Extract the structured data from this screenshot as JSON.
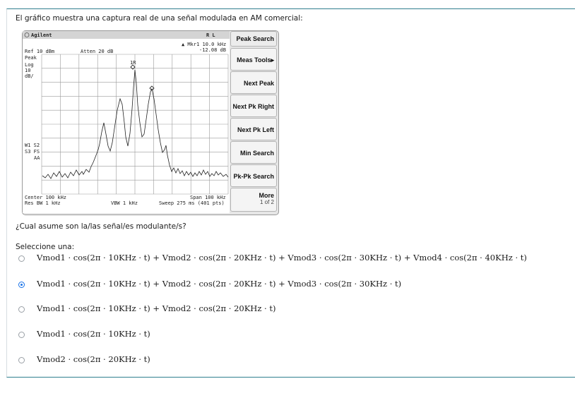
{
  "intro_text": "El gráfico muestra una captura real de una señal modulada en AM comercial:",
  "analyzer": {
    "brand": "Agilent",
    "rl_label": "R L",
    "marker_label": "▲ Mkr1  10.0 kHz",
    "marker_value": "-12.08 dB",
    "ref_level": "Ref 10 dBm",
    "attenuation": "Atten 20 dB",
    "detector": "Peak",
    "scale": [
      "Log",
      "10",
      "dB/"
    ],
    "trace_flags": [
      "W1  S2",
      "S3  FS",
      "AA"
    ],
    "center": "Center 100 kHz",
    "res_bw": "Res BW 1 kHz",
    "vbw": "VBW 1 kHz",
    "span": "Span 100 kHz",
    "sweep": "Sweep 275 ms (401 pts)",
    "marker_tag": "1R",
    "softkeys": {
      "peak_search": "Peak Search",
      "meas_tools": "Meas Tools▸",
      "next_peak": "Next Peak",
      "next_pk_right": "Next Pk Right",
      "next_pk_left": "Next Pk Left",
      "min_search": "Min Search",
      "pk_pk_search": "Pk-Pk Search",
      "more": "More",
      "more_page": "1 of 2"
    },
    "trace_color": "#222222"
  },
  "question": "¿Cual asume son la/las señal/es modulante/s?",
  "select_label": "Seleccione una:",
  "accent_color": "#1a73e8",
  "options": [
    {
      "formula": "Vmod1 · cos(2π · 10KHz · t) + Vmod2 · cos(2π · 20KHz · t) + Vmod3 · cos(2π · 30KHz · t) + Vmod4 · cos(2π · 40KHz · t)",
      "selected": false
    },
    {
      "formula": "Vmod1 · cos(2π · 10KHz · t) + Vmod2 · cos(2π · 20KHz · t) + Vmod3 · cos(2π · 30KHz · t)",
      "selected": true
    },
    {
      "formula": "Vmod1 · cos(2π · 10KHz · t) + Vmod2 · cos(2π · 20KHz · t)",
      "selected": false
    },
    {
      "formula": "Vmod1 · cos(2π · 10KHz · t)",
      "selected": false
    },
    {
      "formula": "Vmod2 · cos(2π · 20KHz · t)",
      "selected": false
    }
  ]
}
